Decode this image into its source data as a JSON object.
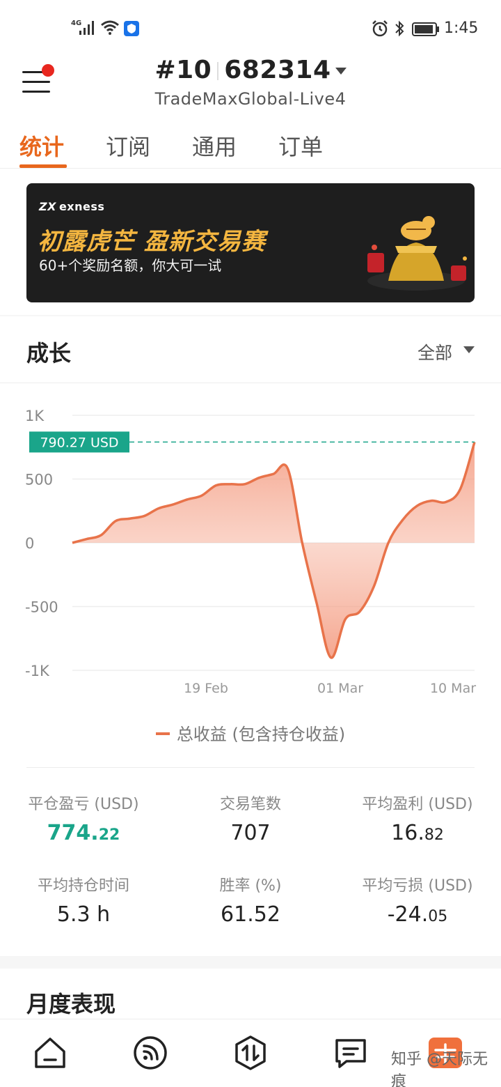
{
  "status_bar": {
    "network": "4G",
    "time": "1:45"
  },
  "header": {
    "account_prefix": "#10",
    "account_suffix": "682314",
    "server": "TradeMaxGlobal-Live4"
  },
  "tabs": [
    {
      "label": "统计"
    },
    {
      "label": "订阅"
    },
    {
      "label": "通用"
    },
    {
      "label": "订单"
    }
  ],
  "banner": {
    "brand": "exness",
    "title": "初露虎芒 盈新交易赛",
    "subtitle": "60+个奖励名额，你大可一试"
  },
  "growth": {
    "title": "成长",
    "filter": "全部",
    "current_value_label": "790.27 USD",
    "legend": "总收益 (包含持仓收益)"
  },
  "chart_data": {
    "type": "area",
    "y_ticks": [
      "1K",
      "500",
      "0",
      "-500",
      "-1K"
    ],
    "x_ticks": [
      "19 Feb",
      "01 Mar",
      "10 Mar"
    ],
    "ylim": [
      -1000,
      1000
    ],
    "current_value": 790.27,
    "series": [
      {
        "name": "总收益 (包含持仓收益)",
        "values": [
          0,
          30,
          60,
          170,
          190,
          210,
          270,
          300,
          340,
          370,
          450,
          460,
          460,
          510,
          540,
          580,
          0,
          -470,
          -900,
          -600,
          -540,
          -340,
          0,
          180,
          290,
          330,
          320,
          420,
          790
        ]
      }
    ]
  },
  "stats": [
    {
      "label": "平仓盈亏 (USD)",
      "int": "774.",
      "frac": "22"
    },
    {
      "label": "交易笔数",
      "int": "707",
      "frac": ""
    },
    {
      "label": "平均盈利 (USD)",
      "int": "16.",
      "frac": "82"
    },
    {
      "label": "平均持仓时间",
      "int": "5.3 h",
      "frac": ""
    },
    {
      "label": "胜率 (%)",
      "int": "61.52",
      "frac": ""
    },
    {
      "label": "平均亏损 (USD)",
      "int": "-24.",
      "frac": "05"
    }
  ],
  "monthly": {
    "title": "月度表现"
  },
  "watermark": "知乎 @天际无痕",
  "colors": {
    "accent": "#e8671d",
    "positive": "#1aa58a",
    "chart_line": "#e8734a",
    "banner_gold": "#f4b640"
  }
}
